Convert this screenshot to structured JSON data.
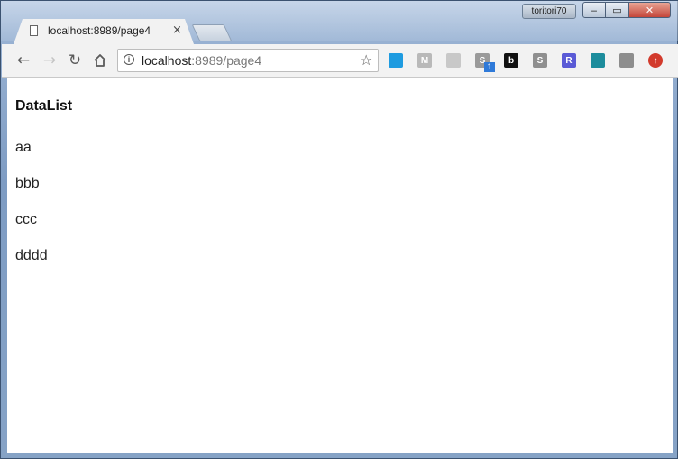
{
  "window": {
    "user_name": "toritori70"
  },
  "tab": {
    "title": "localhost:8989/page4",
    "close_glyph": "×"
  },
  "omnibox": {
    "host": "localhost",
    "rest": ":8989/page4"
  },
  "extensions": [
    {
      "icon": "extension-blue-window-icon",
      "color": "#1e9be0"
    },
    {
      "icon": "extension-m-icon",
      "color": "#b9b9b9"
    },
    {
      "icon": "extension-swirl-icon",
      "color": "#c8c8c8"
    },
    {
      "icon": "extension-s-icon",
      "color": "#9a9a9a"
    },
    {
      "icon": "extension-b-icon",
      "color": "#111111"
    },
    {
      "icon": "extension-s-gray-icon",
      "color": "#8f8f8f"
    },
    {
      "icon": "extension-r-hex-icon",
      "color": "#5a5ad6"
    },
    {
      "icon": "extension-teal-box-icon",
      "color": "#1c8c9c"
    },
    {
      "icon": "extension-shield-icon",
      "color": "#8d8d8d"
    },
    {
      "icon": "extension-up-arrow-icon",
      "color": "#d23a2c"
    }
  ],
  "extension_badge": "1",
  "page": {
    "heading": "DataList",
    "items": [
      "aa",
      "bbb",
      "ccc",
      "dddd"
    ]
  }
}
